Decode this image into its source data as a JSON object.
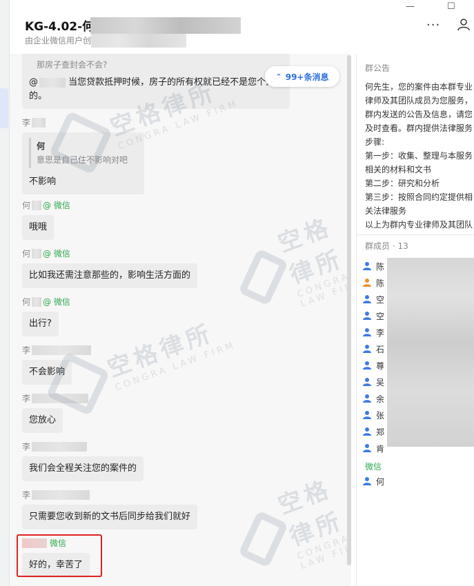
{
  "window": {
    "title": "KG-4.02-何",
    "subtitle": "由企业微信用户创",
    "more_glyph": "···",
    "minimize_glyph": "—",
    "maximize_glyph": "☐"
  },
  "new_messages_pill": {
    "label": "99+条消息",
    "chevron": "⌃"
  },
  "messages": [
    {
      "quote_text": "那房子查封会不会?",
      "text_prefix": "@",
      "text": "当您贷款抵押时候，房子的所有权就已经不是您个人的。"
    },
    {
      "sender": "李",
      "quote_name": "何",
      "quote_text": "意思是自己住不影响对吧",
      "text": "不影响"
    },
    {
      "sender": "何",
      "source": "@ 微信",
      "text": "哦哦"
    },
    {
      "sender": "何",
      "source": "@ 微信",
      "text": "比如我还需注意那些的，影响生活方面的"
    },
    {
      "sender": "何",
      "source": "@ 微信",
      "text": "出行?"
    },
    {
      "sender": "李",
      "text": "不会影响"
    },
    {
      "sender": "李",
      "text": "您放心"
    },
    {
      "sender": "李",
      "text": "我们会全程关注您的案件的"
    },
    {
      "sender": "李",
      "text": "只需要您收到新的文书后同步给我们就好"
    },
    {
      "sender": "",
      "source": "微信",
      "text": "好的，幸苦了"
    }
  ],
  "right_panel": {
    "notice_heading": "群公告",
    "notice_lines": [
      "何先生，您的案件由本群专业",
      "律师及其团队成员为您服务，",
      "群内发送的公告及信息，请您",
      "及时查看。群内提供法律服务",
      "步骤:",
      "第一步：收集、整理与本服务",
      "相关的材料和文书",
      "第二步：研究和分析",
      "第三步：按照合同约定提供相",
      "关法律服务",
      "以上为群内专业律师及其团队"
    ],
    "members_heading": "群成员 · 13",
    "members": [
      "陈",
      "陈",
      "空",
      "空",
      "李",
      "石",
      "尊",
      "吴",
      "余",
      "张",
      "郑",
      "肯"
    ],
    "wechat_heading": "微信",
    "wechat_members": [
      "何"
    ]
  },
  "watermark": {
    "cn": "空格律所",
    "en": "CONGRA LAW FIRM"
  },
  "colors": {
    "accent": "#2f6fdc",
    "wechat_green": "#2fa84f",
    "highlight_red": "#e02020",
    "member_icon_blue": "#3d7be6",
    "member_icon_orange": "#f0902a"
  }
}
